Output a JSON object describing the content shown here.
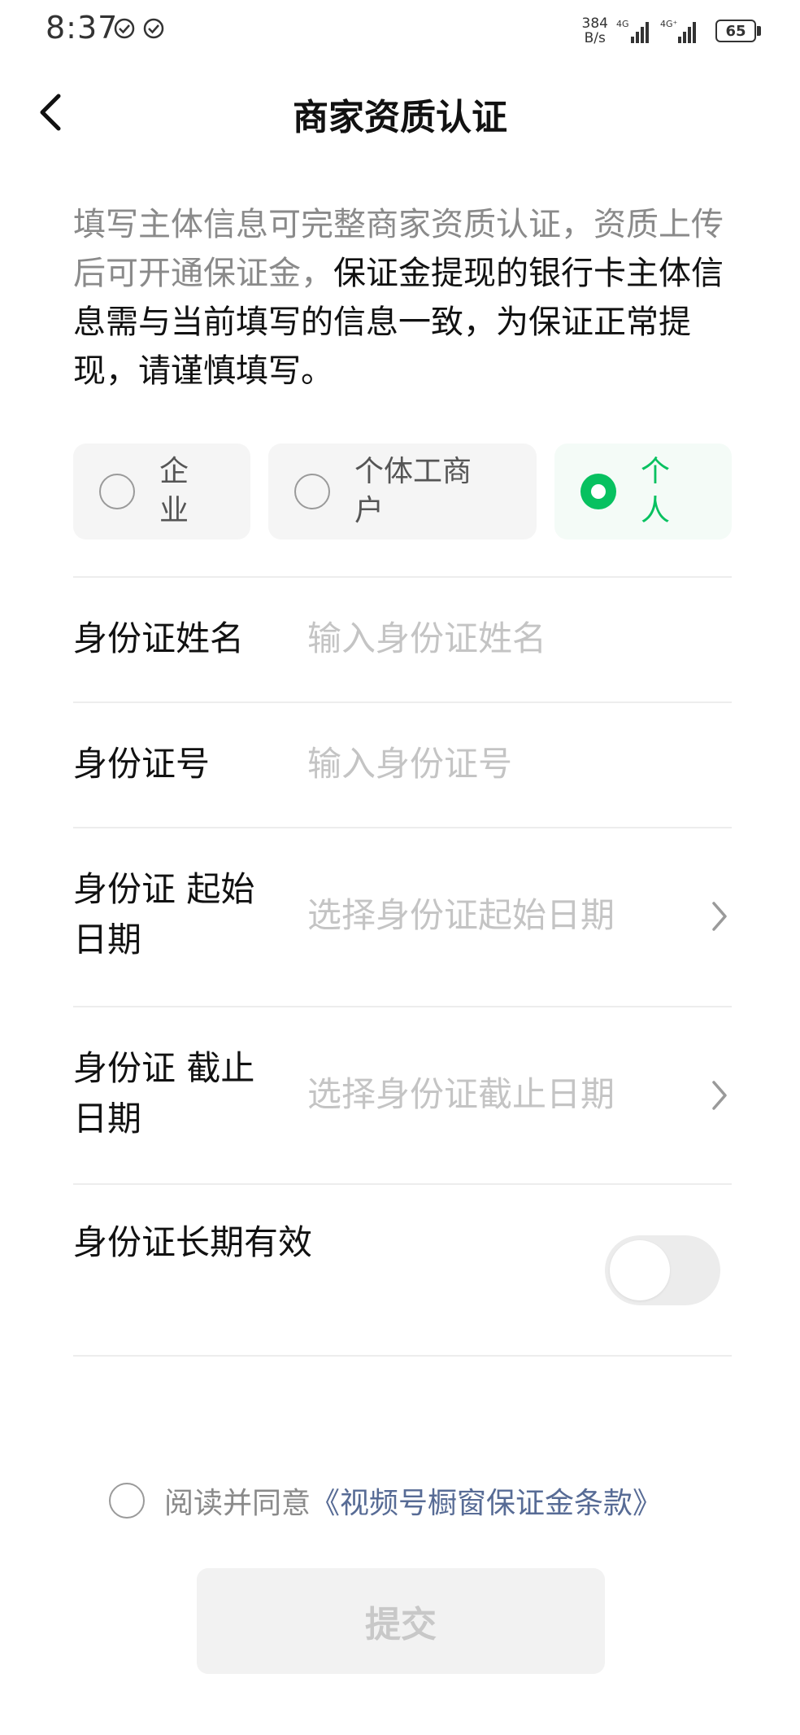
{
  "status_bar": {
    "time": "8:37",
    "net_speed_value": "384",
    "net_speed_unit": "B/s",
    "network_1": "4G",
    "network_2": "4G⁺",
    "battery": "65"
  },
  "nav": {
    "title": "商家资质认证"
  },
  "description": {
    "normal_text": "填写主体信息可完整商家资质认证，资质上传后可开通保证金，",
    "emphasis_text": "保证金提现的银行卡主体信息需与当前填写的信息一致，为保证正常提现，请谨慎填写。"
  },
  "entity_types": {
    "options": [
      {
        "label": "企业",
        "selected": false
      },
      {
        "label": "个体工商户",
        "selected": false
      },
      {
        "label": "个人",
        "selected": true
      }
    ],
    "accent_color": "#07c160"
  },
  "form": {
    "id_name": {
      "label": "身份证姓名",
      "placeholder": "输入身份证姓名"
    },
    "id_number": {
      "label": "身份证号",
      "placeholder": "输入身份证号"
    },
    "start_date": {
      "label": "身份证 起始日期",
      "placeholder": "选择身份证起始日期"
    },
    "end_date": {
      "label": "身份证 截止日期",
      "placeholder": "选择身份证截止日期"
    },
    "long_term": {
      "label": "身份证长期有效",
      "enabled": false
    }
  },
  "agreement": {
    "prefix": "阅读并同意",
    "link_text": "《视频号橱窗保证金条款》",
    "link_color": "#576b95"
  },
  "submit": {
    "label": "提交"
  },
  "icons": [
    "check-circle-icon",
    "signal-icon",
    "battery-icon",
    "back-arrow-icon",
    "chevron-right-icon"
  ]
}
